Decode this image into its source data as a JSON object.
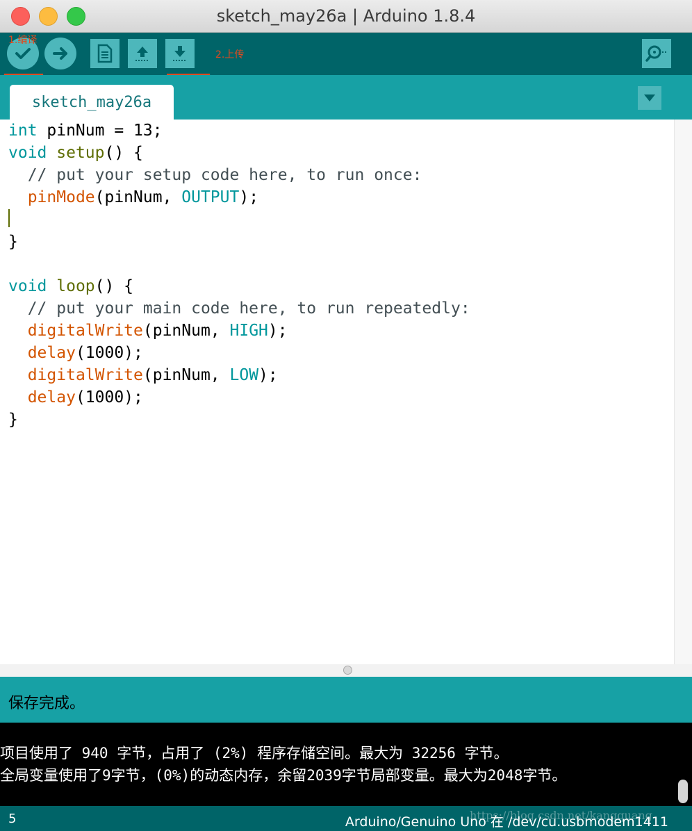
{
  "window": {
    "title": "sketch_may26a | Arduino 1.8.4"
  },
  "toolbar": {
    "verify_icon": "checkmark-icon",
    "upload_icon": "right-arrow-icon",
    "new_icon": "document-icon",
    "open_icon": "up-arrow-icon",
    "save_icon": "down-arrow-icon",
    "serial_monitor_icon": "magnifier-icon",
    "annotation_compile": "1.编译",
    "annotation_upload": "2.上传"
  },
  "tabs": [
    {
      "label": "sketch_may26a",
      "active": true
    }
  ],
  "tab_menu_icon": "triangle-down-icon",
  "editor": {
    "lines": [
      [
        [
          "int",
          "kw-type"
        ],
        [
          " pinNum = 13;",
          ""
        ]
      ],
      [
        [
          "void",
          "kw-type"
        ],
        [
          " ",
          ""
        ],
        [
          "setup",
          "kw-fn"
        ],
        [
          "() {",
          ""
        ]
      ],
      [
        [
          "  // put your setup code here, to run once:",
          "cmt"
        ]
      ],
      [
        [
          "  ",
          ""
        ],
        [
          "pinMode",
          "kw-call"
        ],
        [
          "(pinNum, ",
          ""
        ],
        [
          "OUTPUT",
          "kw-const"
        ],
        [
          ");",
          ""
        ]
      ],
      [
        [
          "",
          ""
        ]
      ],
      [
        [
          "}",
          ""
        ]
      ],
      [
        [
          "",
          ""
        ]
      ],
      [
        [
          "void",
          "kw-type"
        ],
        [
          " ",
          ""
        ],
        [
          "loop",
          "kw-fn"
        ],
        [
          "() {",
          ""
        ]
      ],
      [
        [
          "  // put your main code here, to run repeatedly:",
          "cmt"
        ]
      ],
      [
        [
          "  ",
          ""
        ],
        [
          "digitalWrite",
          "kw-call"
        ],
        [
          "(pinNum, ",
          ""
        ],
        [
          "HIGH",
          "kw-const"
        ],
        [
          ");",
          ""
        ]
      ],
      [
        [
          "  ",
          ""
        ],
        [
          "delay",
          "kw-call"
        ],
        [
          "(1000);",
          ""
        ]
      ],
      [
        [
          "  ",
          ""
        ],
        [
          "digitalWrite",
          "kw-call"
        ],
        [
          "(pinNum, ",
          ""
        ],
        [
          "LOW",
          "kw-const"
        ],
        [
          ");",
          ""
        ]
      ],
      [
        [
          "  ",
          ""
        ],
        [
          "delay",
          "kw-call"
        ],
        [
          "(1000);",
          ""
        ]
      ],
      [
        [
          "}",
          ""
        ]
      ]
    ]
  },
  "status": {
    "message": "保存完成。"
  },
  "console": {
    "lines": [
      "项目使用了 940 字节，占用了 (2%) 程序存储空间。最大为 32256 字节。",
      "全局变量使用了9字节，(0%)的动态内存，余留2039字节局部变量。最大为2048字节。"
    ]
  },
  "footer": {
    "line_number": "5",
    "board": "Arduino/Genuino Uno 在 /dev/cu.usbmodem1411",
    "watermark": "https://blog.csdn.net/kangquang"
  },
  "colors": {
    "toolbar": "#006468",
    "tabstrip": "#17a1a5",
    "button": "#4db7bb",
    "annotation": "#e04a1f"
  }
}
